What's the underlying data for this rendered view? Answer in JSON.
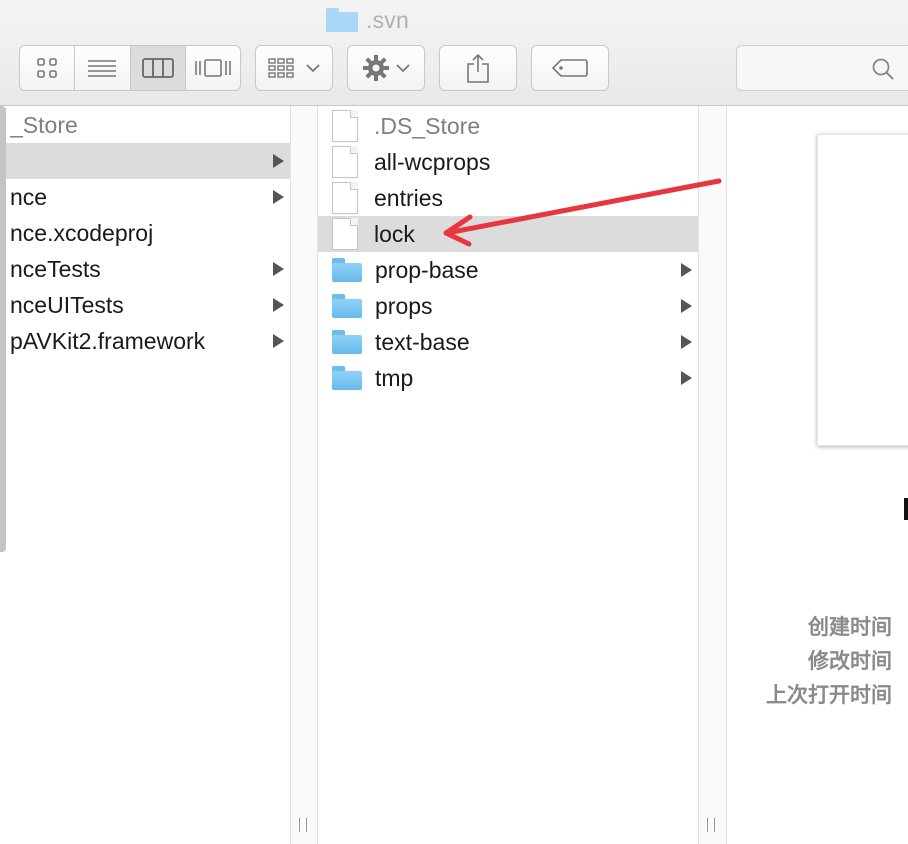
{
  "window": {
    "title": ".svn"
  },
  "toolbar": {
    "view_modes": [
      "icon-view",
      "list-view",
      "column-view",
      "cover-flow-view"
    ],
    "active_view": "column-view",
    "search": {
      "value": "",
      "placeholder": ""
    }
  },
  "column1": {
    "items": [
      {
        "label": "_Store",
        "kind": "text",
        "has_children": false,
        "selected": false,
        "dim": true
      },
      {
        "label": "",
        "kind": "text",
        "has_children": true,
        "selected": true,
        "dim": false
      },
      {
        "label": "nce",
        "kind": "text",
        "has_children": true,
        "selected": false,
        "dim": false
      },
      {
        "label": "nce.xcodeproj",
        "kind": "text",
        "has_children": false,
        "selected": false,
        "dim": false
      },
      {
        "label": "nceTests",
        "kind": "text",
        "has_children": true,
        "selected": false,
        "dim": false
      },
      {
        "label": "nceUITests",
        "kind": "text",
        "has_children": true,
        "selected": false,
        "dim": false
      },
      {
        "label": "pAVKit2.framework",
        "kind": "text",
        "has_children": true,
        "selected": false,
        "dim": false
      }
    ]
  },
  "column2": {
    "items": [
      {
        "label": ".DS_Store",
        "kind": "file",
        "has_children": false,
        "selected": false,
        "dim": true
      },
      {
        "label": "all-wcprops",
        "kind": "file",
        "has_children": false,
        "selected": false,
        "dim": false
      },
      {
        "label": "entries",
        "kind": "file",
        "has_children": false,
        "selected": false,
        "dim": false
      },
      {
        "label": "lock",
        "kind": "file",
        "has_children": false,
        "selected": true,
        "dim": false
      },
      {
        "label": "prop-base",
        "kind": "folder",
        "has_children": true,
        "selected": false,
        "dim": false
      },
      {
        "label": "props",
        "kind": "folder",
        "has_children": true,
        "selected": false,
        "dim": false
      },
      {
        "label": "text-base",
        "kind": "folder",
        "has_children": true,
        "selected": false,
        "dim": false
      },
      {
        "label": "tmp",
        "kind": "folder",
        "has_children": true,
        "selected": false,
        "dim": false
      }
    ]
  },
  "preview": {
    "created_label": "创建时间",
    "modified_label": "修改时间",
    "last_opened_label": "上次打开时间"
  },
  "colors": {
    "selection": "#dcdcdc",
    "folder": "#6cbde9",
    "annotation_arrow": "#e8363f"
  }
}
